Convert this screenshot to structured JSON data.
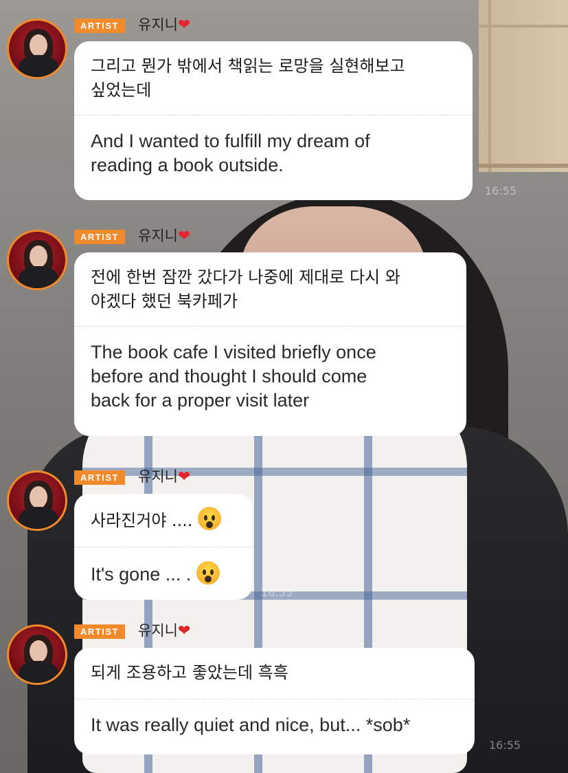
{
  "artist_badge": "ARTIST",
  "username": "유지니",
  "heart_icon": "red-heart",
  "timestamp": "16:55",
  "messages": [
    {
      "korean": [
        "그리고 뭔가 밖에서 책읽는 로망을 실현해보고",
        "싶었는데"
      ],
      "english": [
        "And I wanted to fulfill my dream of",
        "reading a book outside."
      ]
    },
    {
      "korean": [
        "전에 한번 잠깐 갔다가 나중에 제대로 다시 와",
        "야겠다 했던 북카페가"
      ],
      "english": [
        "The book cafe I visited briefly once",
        "before and thought I should come",
        "back for a proper visit later"
      ]
    },
    {
      "korean": [
        "사라진거야 ...."
      ],
      "english": [
        "It's gone ... ."
      ],
      "emoji": "face-screaming-in-fear"
    },
    {
      "korean": [
        "되게 조용하고 좋았는데 흑흑"
      ],
      "english": [
        "It was really quiet and nice, but... *sob*"
      ]
    }
  ]
}
